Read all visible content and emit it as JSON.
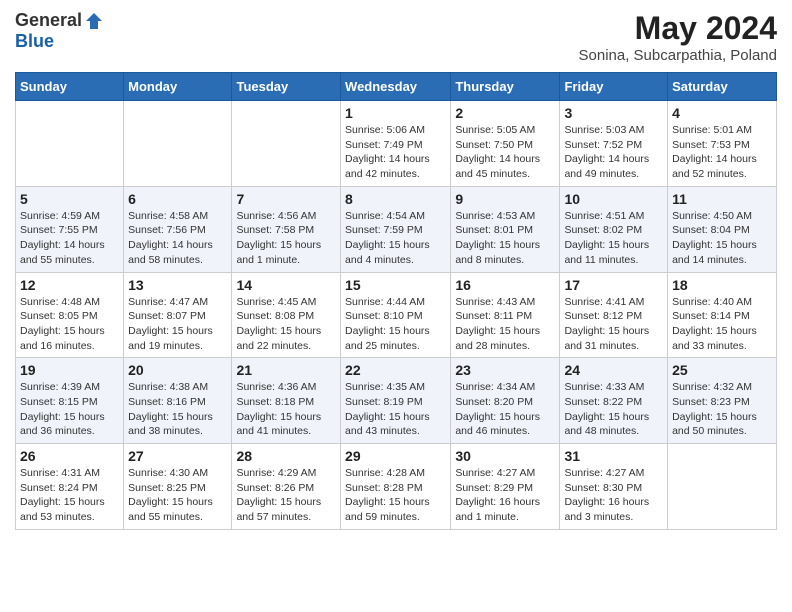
{
  "header": {
    "logo_general": "General",
    "logo_blue": "Blue",
    "month_title": "May 2024",
    "location": "Sonina, Subcarpathia, Poland"
  },
  "days_of_week": [
    "Sunday",
    "Monday",
    "Tuesday",
    "Wednesday",
    "Thursday",
    "Friday",
    "Saturday"
  ],
  "weeks": [
    [
      {
        "day": "",
        "info": ""
      },
      {
        "day": "",
        "info": ""
      },
      {
        "day": "",
        "info": ""
      },
      {
        "day": "1",
        "info": "Sunrise: 5:06 AM\nSunset: 7:49 PM\nDaylight: 14 hours\nand 42 minutes."
      },
      {
        "day": "2",
        "info": "Sunrise: 5:05 AM\nSunset: 7:50 PM\nDaylight: 14 hours\nand 45 minutes."
      },
      {
        "day": "3",
        "info": "Sunrise: 5:03 AM\nSunset: 7:52 PM\nDaylight: 14 hours\nand 49 minutes."
      },
      {
        "day": "4",
        "info": "Sunrise: 5:01 AM\nSunset: 7:53 PM\nDaylight: 14 hours\nand 52 minutes."
      }
    ],
    [
      {
        "day": "5",
        "info": "Sunrise: 4:59 AM\nSunset: 7:55 PM\nDaylight: 14 hours\nand 55 minutes."
      },
      {
        "day": "6",
        "info": "Sunrise: 4:58 AM\nSunset: 7:56 PM\nDaylight: 14 hours\nand 58 minutes."
      },
      {
        "day": "7",
        "info": "Sunrise: 4:56 AM\nSunset: 7:58 PM\nDaylight: 15 hours\nand 1 minute."
      },
      {
        "day": "8",
        "info": "Sunrise: 4:54 AM\nSunset: 7:59 PM\nDaylight: 15 hours\nand 4 minutes."
      },
      {
        "day": "9",
        "info": "Sunrise: 4:53 AM\nSunset: 8:01 PM\nDaylight: 15 hours\nand 8 minutes."
      },
      {
        "day": "10",
        "info": "Sunrise: 4:51 AM\nSunset: 8:02 PM\nDaylight: 15 hours\nand 11 minutes."
      },
      {
        "day": "11",
        "info": "Sunrise: 4:50 AM\nSunset: 8:04 PM\nDaylight: 15 hours\nand 14 minutes."
      }
    ],
    [
      {
        "day": "12",
        "info": "Sunrise: 4:48 AM\nSunset: 8:05 PM\nDaylight: 15 hours\nand 16 minutes."
      },
      {
        "day": "13",
        "info": "Sunrise: 4:47 AM\nSunset: 8:07 PM\nDaylight: 15 hours\nand 19 minutes."
      },
      {
        "day": "14",
        "info": "Sunrise: 4:45 AM\nSunset: 8:08 PM\nDaylight: 15 hours\nand 22 minutes."
      },
      {
        "day": "15",
        "info": "Sunrise: 4:44 AM\nSunset: 8:10 PM\nDaylight: 15 hours\nand 25 minutes."
      },
      {
        "day": "16",
        "info": "Sunrise: 4:43 AM\nSunset: 8:11 PM\nDaylight: 15 hours\nand 28 minutes."
      },
      {
        "day": "17",
        "info": "Sunrise: 4:41 AM\nSunset: 8:12 PM\nDaylight: 15 hours\nand 31 minutes."
      },
      {
        "day": "18",
        "info": "Sunrise: 4:40 AM\nSunset: 8:14 PM\nDaylight: 15 hours\nand 33 minutes."
      }
    ],
    [
      {
        "day": "19",
        "info": "Sunrise: 4:39 AM\nSunset: 8:15 PM\nDaylight: 15 hours\nand 36 minutes."
      },
      {
        "day": "20",
        "info": "Sunrise: 4:38 AM\nSunset: 8:16 PM\nDaylight: 15 hours\nand 38 minutes."
      },
      {
        "day": "21",
        "info": "Sunrise: 4:36 AM\nSunset: 8:18 PM\nDaylight: 15 hours\nand 41 minutes."
      },
      {
        "day": "22",
        "info": "Sunrise: 4:35 AM\nSunset: 8:19 PM\nDaylight: 15 hours\nand 43 minutes."
      },
      {
        "day": "23",
        "info": "Sunrise: 4:34 AM\nSunset: 8:20 PM\nDaylight: 15 hours\nand 46 minutes."
      },
      {
        "day": "24",
        "info": "Sunrise: 4:33 AM\nSunset: 8:22 PM\nDaylight: 15 hours\nand 48 minutes."
      },
      {
        "day": "25",
        "info": "Sunrise: 4:32 AM\nSunset: 8:23 PM\nDaylight: 15 hours\nand 50 minutes."
      }
    ],
    [
      {
        "day": "26",
        "info": "Sunrise: 4:31 AM\nSunset: 8:24 PM\nDaylight: 15 hours\nand 53 minutes."
      },
      {
        "day": "27",
        "info": "Sunrise: 4:30 AM\nSunset: 8:25 PM\nDaylight: 15 hours\nand 55 minutes."
      },
      {
        "day": "28",
        "info": "Sunrise: 4:29 AM\nSunset: 8:26 PM\nDaylight: 15 hours\nand 57 minutes."
      },
      {
        "day": "29",
        "info": "Sunrise: 4:28 AM\nSunset: 8:28 PM\nDaylight: 15 hours\nand 59 minutes."
      },
      {
        "day": "30",
        "info": "Sunrise: 4:27 AM\nSunset: 8:29 PM\nDaylight: 16 hours\nand 1 minute."
      },
      {
        "day": "31",
        "info": "Sunrise: 4:27 AM\nSunset: 8:30 PM\nDaylight: 16 hours\nand 3 minutes."
      },
      {
        "day": "",
        "info": ""
      }
    ]
  ]
}
